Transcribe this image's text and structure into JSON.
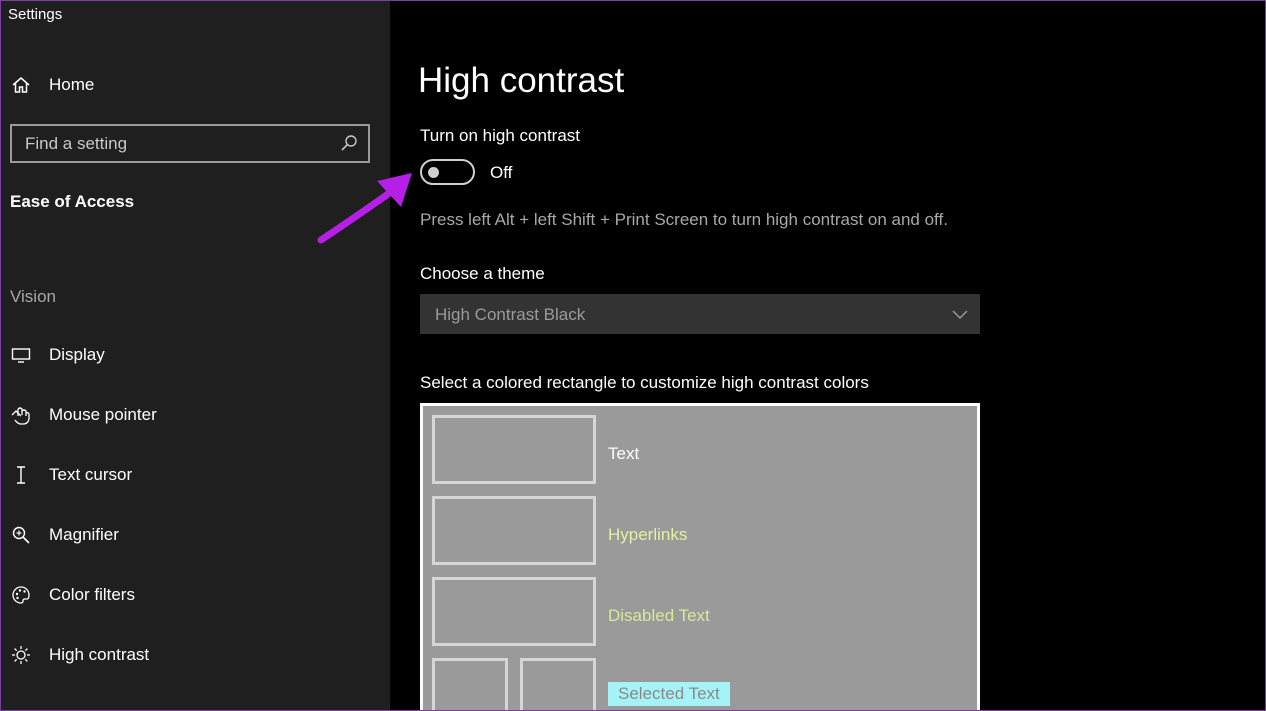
{
  "window": {
    "title": "Settings",
    "controls": [
      "minimize-icon",
      "maximize-icon",
      "close-icon"
    ]
  },
  "sidebar": {
    "home_label": "Home",
    "search_placeholder": "Find a setting",
    "section": "Ease of Access",
    "group": "Vision",
    "items": [
      {
        "label": "Display",
        "icon": "display-icon"
      },
      {
        "label": "Mouse pointer",
        "icon": "mouse-pointer-icon"
      },
      {
        "label": "Text cursor",
        "icon": "text-cursor-icon"
      },
      {
        "label": "Magnifier",
        "icon": "magnifier-icon"
      },
      {
        "label": "Color filters",
        "icon": "color-filters-icon"
      },
      {
        "label": "High contrast",
        "icon": "high-contrast-icon"
      }
    ]
  },
  "main": {
    "title": "High contrast",
    "toggle_label": "Turn on high contrast",
    "toggle_state": "Off",
    "toggle_on": false,
    "shortcut_text": "Press left Alt + left Shift + Print Screen to turn high contrast on and off.",
    "theme_label": "Choose a theme",
    "theme_value": "High Contrast Black",
    "palette_label": "Select a colored rectangle to customize high contrast colors",
    "palette_items": [
      {
        "label": "Text",
        "color": "#ffffff"
      },
      {
        "label": "Hyperlinks",
        "color": "#e3f2a0"
      },
      {
        "label": "Disabled Text",
        "color": "#d6ea9a"
      },
      {
        "label": "Selected Text",
        "color": "#8a8a8a",
        "highlight": "#a6f3f7"
      }
    ]
  },
  "colors": {
    "sidebar_bg": "#1f1f1f",
    "main_bg": "#000000",
    "annotation_arrow": "#b61fe6"
  }
}
